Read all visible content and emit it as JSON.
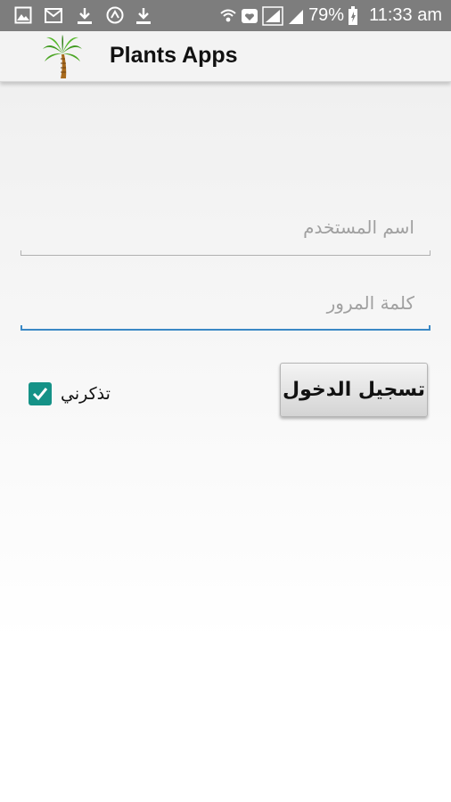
{
  "status_bar": {
    "battery": "79%",
    "time": "11:33 am",
    "icons": [
      "gallery-icon",
      "mail-icon",
      "download-icon",
      "sync-icon",
      "download-icon",
      "wifi-icon",
      "heart-shield-icon",
      "signal-icon",
      "signal-icon",
      "battery-charging-icon"
    ]
  },
  "action_bar": {
    "title": "Plants Apps",
    "logo_icon": "palm-tree-icon"
  },
  "login_form": {
    "username_placeholder": "اسم المستخدم",
    "username_value": "",
    "password_placeholder": "كلمة المرور",
    "password_value": "",
    "login_button": "تسجيل الدخول",
    "remember_label": "تذكرني",
    "remember_checked": true
  },
  "colors": {
    "status_bar": "#7d7d7d",
    "accent_focus": "#3a88c5",
    "checkbox": "#159287"
  }
}
